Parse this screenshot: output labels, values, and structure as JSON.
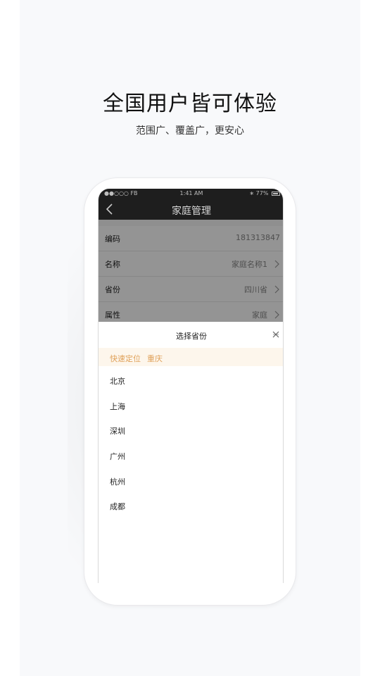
{
  "headline": "全国用户皆可体验",
  "subline": "范围广、覆盖广，更安心",
  "status_bar": {
    "carrier": "●●○○○ FB",
    "time": "1:41 AM",
    "battery": "77%"
  },
  "nav": {
    "back_icon": "chevron-left-icon",
    "title": "家庭管理"
  },
  "form": {
    "rows": [
      {
        "label": "编码",
        "value": "181313847",
        "has_arrow": false
      },
      {
        "label": "名称",
        "value": "家庭名称1",
        "has_arrow": true
      },
      {
        "label": "省份",
        "value": "四川省",
        "has_arrow": true
      },
      {
        "label": "属性",
        "value": "家庭",
        "has_arrow": true
      }
    ]
  },
  "province_sheet": {
    "title": "选择省份",
    "close_icon": "close-icon",
    "quick_locate_label": "快速定位",
    "quick_locate_city": "重庆",
    "cities": [
      "北京",
      "上海",
      "深圳",
      "广州",
      "杭州",
      "成都"
    ]
  },
  "colors": {
    "nav_bg": "#1e1e1e",
    "accent": "#e0a15a",
    "quick_bg": "#fdf6ec"
  }
}
